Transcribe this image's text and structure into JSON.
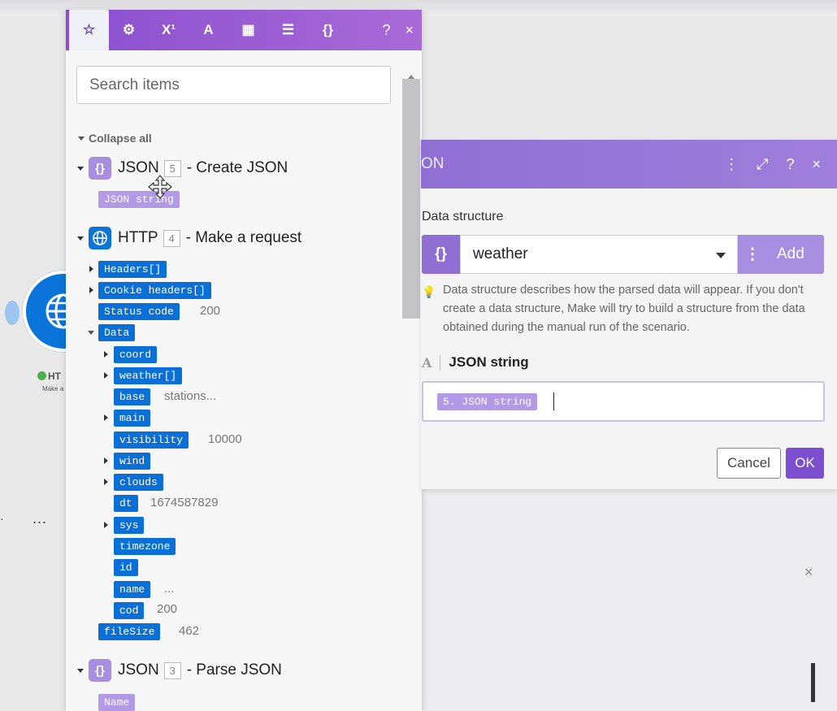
{
  "canvas": {
    "node_label": "HT",
    "node_sub": "Make a",
    "more_label": "..."
  },
  "panel": {
    "tabs": [
      {
        "icon": "star-icon",
        "glyph": "☆"
      },
      {
        "icon": "gear-icon",
        "glyph": "⚙"
      },
      {
        "icon": "superscript-icon",
        "glyph": "X¹"
      },
      {
        "icon": "text-icon",
        "glyph": "A"
      },
      {
        "icon": "calendar-icon",
        "glyph": "▦"
      },
      {
        "icon": "table-icon",
        "glyph": "☰"
      },
      {
        "icon": "braces-icon",
        "glyph": "{}"
      }
    ],
    "help_label": "?",
    "close_label": "×",
    "search_placeholder": "Search items",
    "collapse_all": "Collapse all",
    "modules": [
      {
        "name": "JSON",
        "num": "5",
        "desc": "- Create JSON",
        "icon_glyph": "{}"
      },
      {
        "name": "HTTP",
        "num": "4",
        "desc": "- Make a request"
      },
      {
        "name": "JSON",
        "num": "3",
        "desc": "- Parse JSON",
        "icon_glyph": "{}"
      }
    ],
    "items": {
      "json_string": "JSON string",
      "headers": "Headers[]",
      "cookie_headers": "Cookie headers[]",
      "status_code": "Status code",
      "status_code_val": "200",
      "data": "Data",
      "coord": "coord",
      "weather": "weather[]",
      "base": "base",
      "base_val": "stations...",
      "main": "main",
      "visibility": "visibility",
      "visibility_val": "10000",
      "wind": "wind",
      "clouds": "clouds",
      "dt": "dt",
      "dt_val": "1674587829",
      "sys": "sys",
      "timezone": "timezone",
      "id": "id",
      "name": "name",
      "name_val": "...",
      "cod": "cod",
      "cod_val": "200",
      "filesize": "fileSize",
      "filesize_val": "462",
      "parse_name": "Name"
    }
  },
  "dialog": {
    "title": "ON",
    "help_label": "?",
    "close_label": "×",
    "data_structure_label": "Data structure",
    "data_structure_value": "weather",
    "add_label": "Add",
    "hint": "Data structure describes how the parsed data will appear. If you don't create a data structure, Make will try to build a structure from the data obtained during the manual run of the scenario.",
    "json_string_label": "JSON string",
    "json_string_token": "5. JSON string",
    "cancel_label": "Cancel",
    "ok_label": "OK"
  },
  "colors": {
    "accent_purple": "#8f6fd3",
    "pill_blue": "#0a6fd6",
    "pill_purple": "#b39ae6",
    "http_blue": "#0a74da"
  }
}
